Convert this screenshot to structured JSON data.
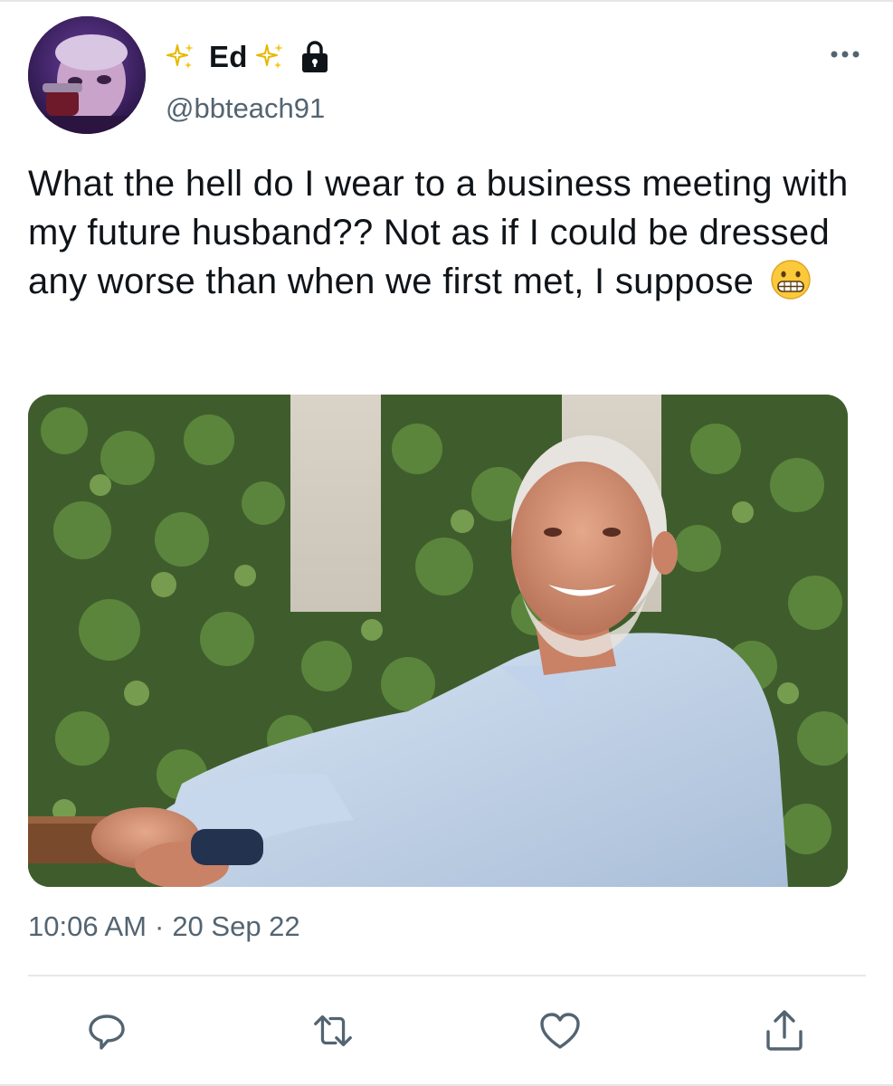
{
  "tweet": {
    "author": {
      "display_name": "Ed",
      "handle": "@bbteach91",
      "protected_icon": "lock-icon",
      "name_decoration_icon": "sparkles-icon"
    },
    "text": "What the hell do I wear to a business meeting with my future husband?? Not as if I could be dressed any worse than when we first met, I suppose",
    "emoji": "grimacing-face-emoji",
    "time": "10:06 AM",
    "separator": "·",
    "date": "20 Sep 22",
    "media": {
      "kind": "photo"
    },
    "actions": [
      {
        "name": "reply",
        "icon": "reply-icon"
      },
      {
        "name": "retweet",
        "icon": "retweet-icon"
      },
      {
        "name": "like",
        "icon": "heart-icon"
      },
      {
        "name": "share",
        "icon": "share-icon"
      }
    ]
  },
  "colors": {
    "text_primary": "#0f1419",
    "text_secondary": "#536471",
    "divider": "#e8e8e8",
    "sparkle": "#f5c518"
  }
}
